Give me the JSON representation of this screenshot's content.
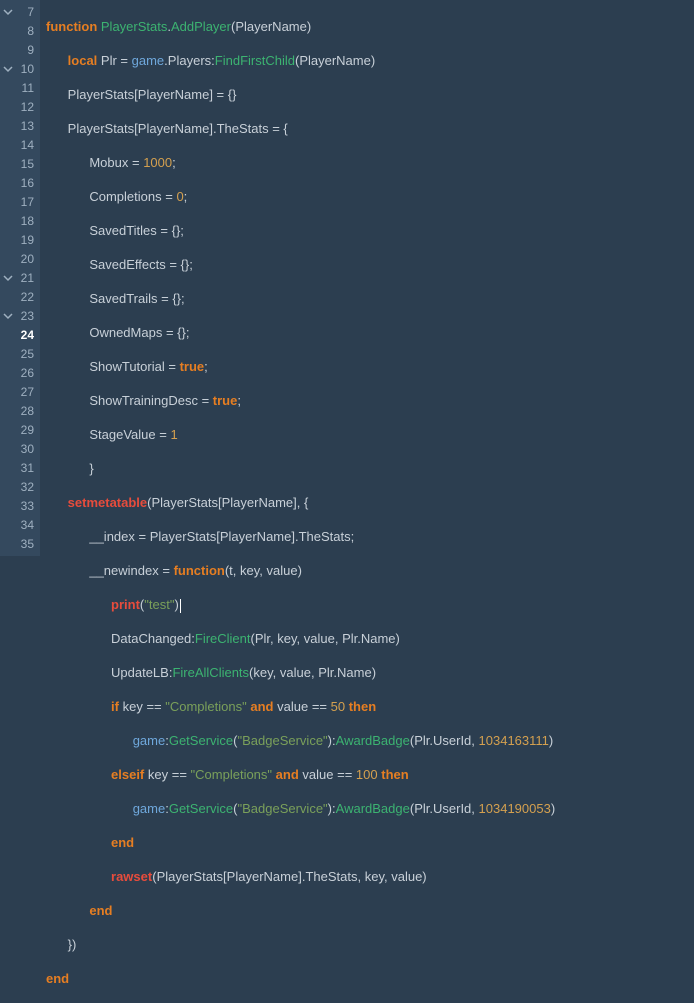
{
  "lines": [
    {
      "n": "7",
      "fold": true,
      "active": false
    },
    {
      "n": "8",
      "fold": false,
      "active": false
    },
    {
      "n": "9",
      "fold": false,
      "active": false
    },
    {
      "n": "10",
      "fold": true,
      "active": false
    },
    {
      "n": "11",
      "fold": false,
      "active": false
    },
    {
      "n": "12",
      "fold": false,
      "active": false
    },
    {
      "n": "13",
      "fold": false,
      "active": false
    },
    {
      "n": "14",
      "fold": false,
      "active": false
    },
    {
      "n": "15",
      "fold": false,
      "active": false
    },
    {
      "n": "16",
      "fold": false,
      "active": false
    },
    {
      "n": "17",
      "fold": false,
      "active": false
    },
    {
      "n": "18",
      "fold": false,
      "active": false
    },
    {
      "n": "19",
      "fold": false,
      "active": false
    },
    {
      "n": "20",
      "fold": false,
      "active": false
    },
    {
      "n": "21",
      "fold": true,
      "active": false
    },
    {
      "n": "22",
      "fold": false,
      "active": false
    },
    {
      "n": "23",
      "fold": true,
      "active": false
    },
    {
      "n": "24",
      "fold": false,
      "active": true
    },
    {
      "n": "25",
      "fold": false,
      "active": false
    },
    {
      "n": "26",
      "fold": false,
      "active": false
    },
    {
      "n": "27",
      "fold": false,
      "active": false
    },
    {
      "n": "28",
      "fold": false,
      "active": false
    },
    {
      "n": "29",
      "fold": false,
      "active": false
    },
    {
      "n": "30",
      "fold": false,
      "active": false
    },
    {
      "n": "31",
      "fold": false,
      "active": false
    },
    {
      "n": "32",
      "fold": false,
      "active": false
    },
    {
      "n": "33",
      "fold": false,
      "active": false
    },
    {
      "n": "34",
      "fold": false,
      "active": false
    },
    {
      "n": "35",
      "fold": false,
      "active": false
    }
  ],
  "t": {
    "function": "function",
    "local": "local",
    "if": "if",
    "and": "and",
    "then": "then",
    "elseif": "elseif",
    "end": "end",
    "true": "true",
    "setmetatable": "setmetatable",
    "rawset": "rawset",
    "print": "print",
    "PlayerStats": "PlayerStats",
    "AddPlayer": "AddPlayer",
    "PlayerName": "PlayerName",
    "Plr": "Plr",
    "game": "game",
    "Players": "Players",
    "FindFirstChild": "FindFirstChild",
    "TheStats": "TheStats",
    "Mobux": "Mobux",
    "Completions": "Completions",
    "SavedTitles": "SavedTitles",
    "SavedEffects": "SavedEffects",
    "SavedTrails": "SavedTrails",
    "OwnedMaps": "OwnedMaps",
    "ShowTutorial": "ShowTutorial",
    "ShowTrainingDesc": "ShowTrainingDesc",
    "StageValue": "StageValue",
    "__index": "__index",
    "__newindex": "__newindex",
    "t_p": "t",
    "key": "key",
    "value": "value",
    "DataChanged": "DataChanged",
    "FireClient": "FireClient",
    "Name": "Name",
    "UpdateLB": "UpdateLB",
    "FireAllClients": "FireAllClients",
    "GetService": "GetService",
    "BadgeService": "\"BadgeService\"",
    "AwardBadge": "AwardBadge",
    "UserId": "UserId",
    "n1000": "1000",
    "n0": "0",
    "n1": "1",
    "n50": "50",
    "n100": "100",
    "badge1": "1034163111",
    "badge2": "1034190053",
    "strCompletions": "\"Completions\"",
    "strTest": "\"test\"",
    "eq": " = ",
    "eqop": " == ",
    "dot": ".",
    "col": ":",
    "com": ", ",
    "semi": ";",
    "lp": "(",
    "rp": ")",
    "lb": "{",
    "rb": "}",
    "lbr": "[",
    "rbr": "]",
    "rpb": "})"
  }
}
